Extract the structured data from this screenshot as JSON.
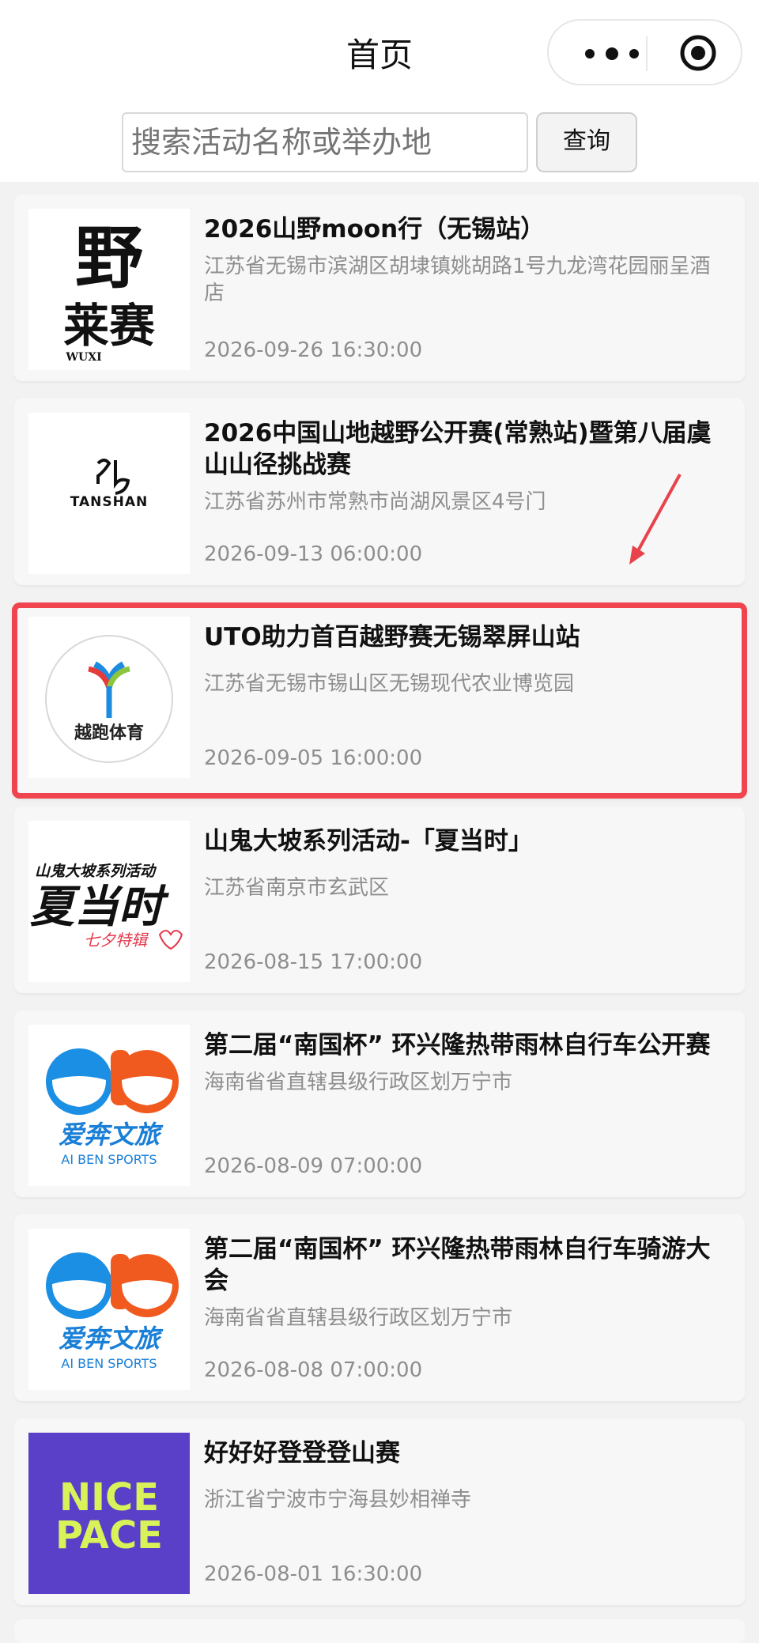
{
  "header": {
    "title": "首页"
  },
  "capsule": {
    "more_icon": "more-dots-icon",
    "close_icon": "target-icon"
  },
  "search": {
    "placeholder": "搜索活动名称或举办地",
    "button_label": "查询"
  },
  "events": [
    {
      "title": "2026山野moon行（无锡站）",
      "address": "江苏省无锡市滨湖区胡埭镇姚胡路1号九龙湾花园丽呈酒店",
      "time": "2026-09-26 16:30:00",
      "logo_text": "野 莱赛",
      "logo_sub": "WUXI"
    },
    {
      "title": "2026中国山地越野公开赛(常熟站)暨第八届虞山山径挑战赛",
      "address": "江苏省苏州市常熟市尚湖风景区4号门",
      "time": "2026-09-13 06:00:00",
      "logo_text": "TANSHAN"
    },
    {
      "title": "UTO助力首百越野赛无锡翠屏山站",
      "address": "江苏省无锡市锡山区无锡现代农业博览园",
      "time": "2026-09-05 16:00:00",
      "logo_text": "越跑体育",
      "highlighted": true
    },
    {
      "title": "山鬼大坡系列活动-「夏当时」",
      "address": "江苏省南京市玄武区",
      "time": "2026-08-15 17:00:00",
      "logo_text": "山鬼大坡系列活动",
      "logo_main": "夏当时",
      "logo_sub": "七夕特辑"
    },
    {
      "title": "第二届“南国杯” 环兴隆热带雨林自行车公开赛",
      "address": "海南省省直辖县级行政区划万宁市",
      "time": "2026-08-09 07:00:00",
      "logo_text": "爱奔文旅",
      "logo_sub": "AI BEN SPORTS"
    },
    {
      "title": "第二届“南国杯” 环兴隆热带雨林自行车骑游大会",
      "address": "海南省省直辖县级行政区划万宁市",
      "time": "2026-08-08 07:00:00",
      "logo_text": "爱奔文旅",
      "logo_sub": "AI BEN SPORTS"
    },
    {
      "title": "好好好登登登山赛",
      "address": "浙江省宁波市宁海县妙相禅寺",
      "time": "2026-08-01 16:30:00",
      "logo_text": "NICE",
      "logo_sub": "PACE"
    }
  ],
  "colors": {
    "highlight": "#f0454f",
    "arrow": "#e8434b",
    "nice_pace_bg": "#5a3fc8",
    "nice_pace_text": "#d8f25a",
    "aiben_blue": "#1a8fe3",
    "aiben_orange": "#f05a1e"
  }
}
